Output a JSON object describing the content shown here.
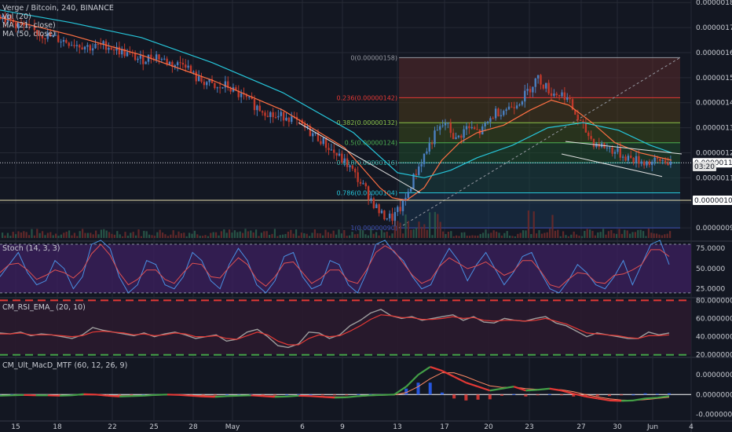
{
  "colors": {
    "bg": "#131722",
    "grid": "#262a35",
    "axis_text": "#c9ccd3",
    "candle_up": "#4a7fc0",
    "candle_down": "#c0392b",
    "ma21": "#ff7043",
    "ma50": "#26c6da",
    "stoch_bg": "#3b1f5c",
    "stoch_k": "#4a90e2",
    "stoch_d": "#e05050",
    "rsi_line": "#9e9e9e",
    "rsi_ema": "#e53935",
    "rsi_upper": "#e53935",
    "rsi_lower": "#43a047",
    "macd_line_up": "#43a047",
    "macd_line_down": "#e53935",
    "macd_signal": "#ff8a65"
  },
  "legend": {
    "symbol": "Verge / Bitcoin, 240, BINANCE",
    "vol": "Vol (20)",
    "ma21": "MA (21, close)",
    "ma50": "MA (50, close)"
  },
  "chart_data": [
    {
      "type": "candlestick",
      "title": "Verge / Bitcoin, 240, BINANCE",
      "ylim": [
        8.5e-07,
        1.81e-06
      ],
      "y_ticks": [
        "0.00000090",
        "0.00000100",
        "0.00000110",
        "0.00000120",
        "0.00000130",
        "0.00000140",
        "0.00000150",
        "0.00000160",
        "0.00000170",
        "0.00000180"
      ],
      "x_ticks": [
        "15",
        "18",
        "22",
        "25",
        "28",
        "May",
        "6",
        "9",
        "13",
        "17",
        "20",
        "23",
        "27",
        "30",
        "Jun",
        "4"
      ],
      "close_path": [
        [
          0,
          1.75
        ],
        [
          10,
          1.71
        ],
        [
          25,
          1.67
        ],
        [
          40,
          1.64
        ],
        [
          52,
          1.62
        ],
        [
          60,
          1.63
        ],
        [
          70,
          1.6
        ],
        [
          80,
          1.57
        ],
        [
          88,
          1.59
        ],
        [
          95,
          1.56
        ],
        [
          100,
          1.55
        ],
        [
          104,
          1.57
        ],
        [
          108,
          1.52
        ],
        [
          112,
          1.49
        ],
        [
          118,
          1.48
        ],
        [
          122,
          1.45
        ],
        [
          128,
          1.47
        ],
        [
          133,
          1.44
        ],
        [
          140,
          1.41
        ],
        [
          146,
          1.38
        ],
        [
          152,
          1.36
        ],
        [
          156,
          1.34
        ],
        [
          162,
          1.35
        ],
        [
          168,
          1.32
        ],
        [
          176,
          1.28
        ],
        [
          182,
          1.25
        ],
        [
          186,
          1.22
        ],
        [
          192,
          1.18
        ],
        [
          197,
          1.15
        ],
        [
          202,
          1.1
        ],
        [
          207,
          1.05
        ],
        [
          212,
          0.99
        ],
        [
          216,
          0.95
        ],
        [
          222,
          0.94
        ],
        [
          228,
          0.99
        ],
        [
          234,
          1.1
        ],
        [
          240,
          1.19
        ],
        [
          246,
          1.27
        ],
        [
          252,
          1.32
        ],
        [
          258,
          1.25
        ],
        [
          264,
          1.3
        ],
        [
          272,
          1.28
        ],
        [
          280,
          1.36
        ],
        [
          288,
          1.38
        ],
        [
          296,
          1.42
        ],
        [
          304,
          1.5
        ],
        [
          312,
          1.44
        ],
        [
          320,
          1.43
        ],
        [
          328,
          1.32
        ],
        [
          336,
          1.24
        ],
        [
          344,
          1.22
        ],
        [
          352,
          1.19
        ],
        [
          360,
          1.17
        ],
        [
          368,
          1.16
        ],
        [
          376,
          1.17
        ],
        [
          380,
          1.16
        ]
      ],
      "ma21_path": [
        [
          0,
          1.74
        ],
        [
          40,
          1.67
        ],
        [
          80,
          1.59
        ],
        [
          120,
          1.49
        ],
        [
          160,
          1.37
        ],
        [
          195,
          1.22
        ],
        [
          215,
          1.06
        ],
        [
          222,
          1.02
        ],
        [
          230,
          1.01
        ],
        [
          240,
          1.06
        ],
        [
          250,
          1.17
        ],
        [
          260,
          1.24
        ],
        [
          270,
          1.28
        ],
        [
          285,
          1.31
        ],
        [
          300,
          1.37
        ],
        [
          312,
          1.41
        ],
        [
          322,
          1.39
        ],
        [
          335,
          1.32
        ],
        [
          348,
          1.24
        ],
        [
          362,
          1.2
        ],
        [
          380,
          1.17
        ]
      ],
      "ma50_path": [
        [
          0,
          1.77
        ],
        [
          40,
          1.72
        ],
        [
          80,
          1.66
        ],
        [
          120,
          1.56
        ],
        [
          160,
          1.44
        ],
        [
          200,
          1.28
        ],
        [
          225,
          1.12
        ],
        [
          240,
          1.1
        ],
        [
          255,
          1.13
        ],
        [
          270,
          1.18
        ],
        [
          290,
          1.23
        ],
        [
          310,
          1.3
        ],
        [
          330,
          1.32
        ],
        [
          350,
          1.29
        ],
        [
          368,
          1.23
        ],
        [
          380,
          1.2
        ]
      ],
      "fibonacci": [
        {
          "label": "0(0.00000158)",
          "value": 1.58,
          "color": "#9598a1"
        },
        {
          "label": "0.236(0.00000142)",
          "value": 1.42,
          "color": "#e53935"
        },
        {
          "label": "0.382(0.00000132)",
          "value": 1.32,
          "color": "#8bc34a"
        },
        {
          "label": "0.5(0.00000124)",
          "value": 1.24,
          "color": "#4caf50"
        },
        {
          "label": "0.618(0.00000116)",
          "value": 1.16,
          "color": "#26a69a"
        },
        {
          "label": "0.786(0.00000104)",
          "value": 1.04,
          "color": "#26c6da"
        },
        {
          "label": "1(0.00000090)",
          "value": 0.9,
          "color": "#3f51b5"
        }
      ],
      "price_labels": [
        {
          "text": "0.00000116",
          "value": 1.16,
          "bg": "#ffffff",
          "fg": "#131722"
        },
        {
          "text": "03:20",
          "value": 1.145,
          "bg": "#e0e0e0",
          "fg": "#131722"
        },
        {
          "text": "0.00000101",
          "value": 1.01,
          "bg": "#ffffff",
          "fg": "#131722"
        }
      ]
    },
    {
      "type": "line",
      "title": "Stoch (14, 3, 3)",
      "ylim": [
        15,
        82
      ],
      "y_ticks": [
        "25.0000",
        "50.0000",
        "75.0000"
      ],
      "bands": [
        80,
        20
      ],
      "k_values": [
        40,
        55,
        70,
        45,
        30,
        35,
        60,
        50,
        25,
        40,
        80,
        85,
        75,
        40,
        20,
        30,
        60,
        55,
        30,
        25,
        40,
        70,
        60,
        35,
        25,
        55,
        75,
        60,
        30,
        20,
        35,
        65,
        70,
        40,
        25,
        30,
        60,
        55,
        30,
        20,
        45,
        80,
        85,
        70,
        60,
        40,
        25,
        30,
        55,
        75,
        60,
        35,
        55,
        70,
        50,
        30,
        45,
        65,
        70,
        45,
        25,
        20,
        35,
        55,
        45,
        30,
        25,
        40,
        60,
        30,
        55,
        80,
        85,
        55
      ]
    },
    {
      "type": "line",
      "title": "CM_RSI_EMA_ (20, 10)",
      "ylim": [
        18,
        82
      ],
      "y_ticks": [
        "20.0000000",
        "40.0000000",
        "60.0000000",
        "80.0000000"
      ],
      "bands": [
        80,
        20
      ],
      "rsi_values": [
        44,
        43,
        45,
        41,
        43,
        42,
        40,
        38,
        42,
        50,
        47,
        45,
        43,
        41,
        44,
        40,
        43,
        45,
        42,
        38,
        40,
        42,
        35,
        37,
        45,
        48,
        40,
        30,
        28,
        32,
        45,
        44,
        38,
        42,
        52,
        58,
        66,
        70,
        63,
        60,
        62,
        58,
        60,
        62,
        64,
        58,
        62,
        56,
        55,
        60,
        58,
        57,
        60,
        62,
        55,
        52,
        46,
        40,
        44,
        42,
        40,
        38,
        38,
        45,
        42,
        44
      ],
      "rsi_ema_values": [
        43,
        43,
        44,
        42,
        42,
        42,
        41,
        40,
        41,
        45,
        46,
        45,
        44,
        42,
        43,
        41,
        42,
        44,
        43,
        40,
        40,
        41,
        38,
        37,
        41,
        45,
        42,
        35,
        31,
        31,
        38,
        42,
        40,
        41,
        46,
        52,
        59,
        64,
        63,
        61,
        61,
        59,
        59,
        60,
        62,
        60,
        61,
        58,
        57,
        58,
        58,
        57,
        58,
        60,
        57,
        54,
        49,
        44,
        43,
        42,
        41,
        39,
        38,
        41,
        41,
        42
      ]
    },
    {
      "type": "line",
      "title": "CM_Ult_MacD_MTF (60, 12, 26, 9)",
      "ylim": [
        -6.5e-09,
        9e-09
      ],
      "y_ticks": [
        "-0.00000005",
        "0.00000000",
        "0.00000005"
      ],
      "macd_values": [
        -0.3,
        -0.2,
        -0.1,
        -0.2,
        -0.2,
        -0.3,
        -0.2,
        0.1,
        0.0,
        -0.3,
        -0.5,
        -0.4,
        -0.3,
        -0.1,
        0.0,
        -0.1,
        -0.3,
        -0.5,
        -0.6,
        -0.4,
        -0.3,
        -0.2,
        -0.4,
        -0.6,
        -0.5,
        -0.3,
        -0.4,
        -0.6,
        -0.8,
        -0.7,
        -0.4,
        -0.2,
        -0.1,
        0.0,
        2.0,
        5.0,
        7.0,
        6.0,
        4.5,
        3.0,
        2.0,
        1.0,
        1.5,
        2.0,
        1.0,
        1.2,
        1.5,
        1.0,
        0.2,
        -0.5,
        -1.0,
        -1.5,
        -1.6,
        -1.5,
        -1.0,
        -0.8,
        -0.4
      ],
      "signal_values": [
        -0.2,
        -0.2,
        -0.2,
        -0.2,
        -0.2,
        -0.2,
        -0.2,
        -0.1,
        -0.1,
        -0.2,
        -0.3,
        -0.3,
        -0.3,
        -0.2,
        -0.1,
        -0.1,
        -0.2,
        -0.3,
        -0.4,
        -0.4,
        -0.3,
        -0.3,
        -0.3,
        -0.4,
        -0.5,
        -0.4,
        -0.4,
        -0.5,
        -0.6,
        -0.6,
        -0.5,
        -0.3,
        -0.2,
        -0.1,
        0.5,
        2.0,
        4.0,
        5.5,
        5.5,
        4.5,
        3.3,
        2.2,
        1.8,
        1.9,
        1.5,
        1.3,
        1.4,
        1.2,
        0.7,
        0.0,
        -0.6,
        -1.1,
        -1.4,
        -1.5,
        -1.3,
        -1.0,
        -0.7
      ],
      "histogram": [
        0,
        0.1,
        0.1,
        0,
        0,
        -0.1,
        0,
        0.2,
        0.1,
        -0.1,
        -0.2,
        -0.1,
        0,
        0.1,
        0.1,
        0,
        -0.1,
        -0.2,
        -0.2,
        0,
        0,
        0.1,
        -0.1,
        -0.2,
        0,
        0.1,
        0,
        -0.1,
        -0.2,
        -0.1,
        0.1,
        0.1,
        0.1,
        0.1,
        1.5,
        3.0,
        3.0,
        0.5,
        -1.0,
        -1.5,
        -1.3,
        -1.2,
        -0.3,
        0.1,
        -0.5,
        -0.1,
        0.1,
        -0.2,
        -0.5,
        -0.5,
        -0.4,
        -0.4,
        -0.2,
        0,
        0.3,
        0.2,
        0.3
      ]
    }
  ],
  "panes": {
    "stoch_title": "Stoch (14, 3, 3)",
    "rsi_title": "CM_RSI_EMA_ (20, 10)",
    "macd_title": "CM_Ult_MacD_MTF (60, 12, 26, 9)"
  }
}
